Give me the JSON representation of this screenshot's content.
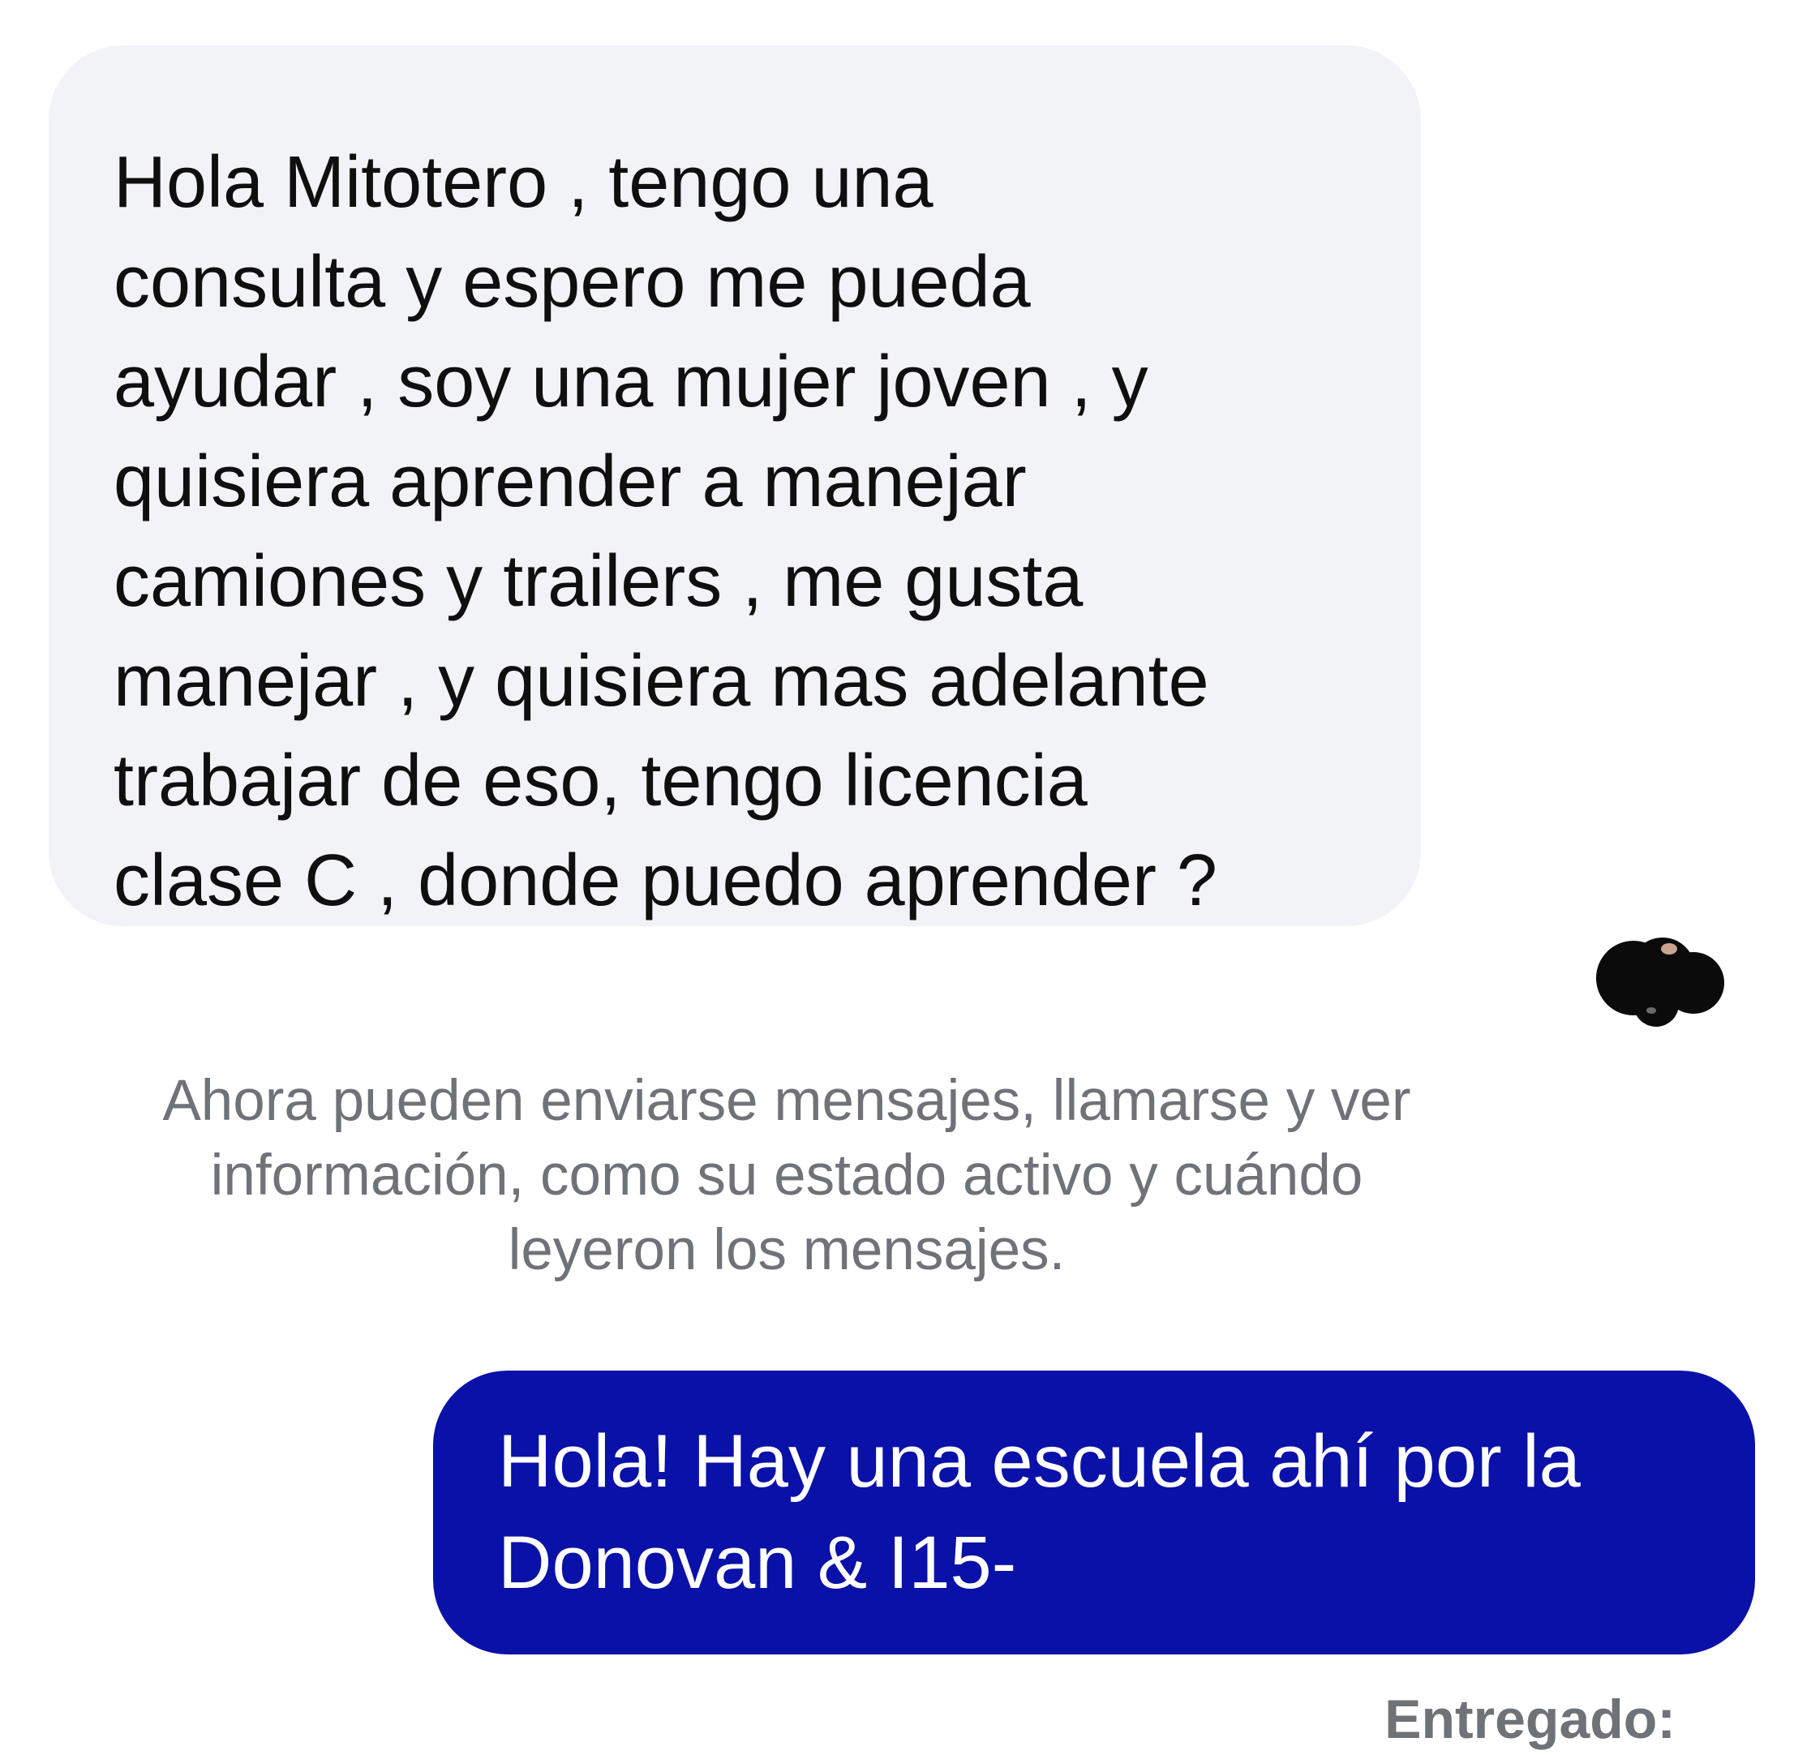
{
  "incoming_message": {
    "lines": [
      "Hola Mitotero , tengo una",
      "consulta y espero me pueda",
      "ayudar , soy una mujer joven , y",
      "quisiera aprender a manejar",
      "camiones y trailers , me gusta",
      "manejar , y quisiera mas adelante",
      "trabajar de eso,  tengo licencia",
      "clase C , donde puedo aprender ?"
    ],
    "background_color": "#f2f3f6",
    "text_color": "#0f0f0f"
  },
  "read_receipt": {
    "icon": "redacted-avatar-icon"
  },
  "system_note": {
    "lines": [
      "Ahora pueden enviarse mensajes, llamarse y ver",
      "información, como su estado activo y cuándo",
      "leyeron los mensajes."
    ],
    "text_color": "#6f7277"
  },
  "outgoing_message": {
    "lines": [
      "Hola! Hay una escuela ahí por la",
      "Donovan & I15-"
    ],
    "background_color": "#0a11a8",
    "text_color": "#ffffff"
  },
  "delivery_status": {
    "label": "Entregado:"
  }
}
